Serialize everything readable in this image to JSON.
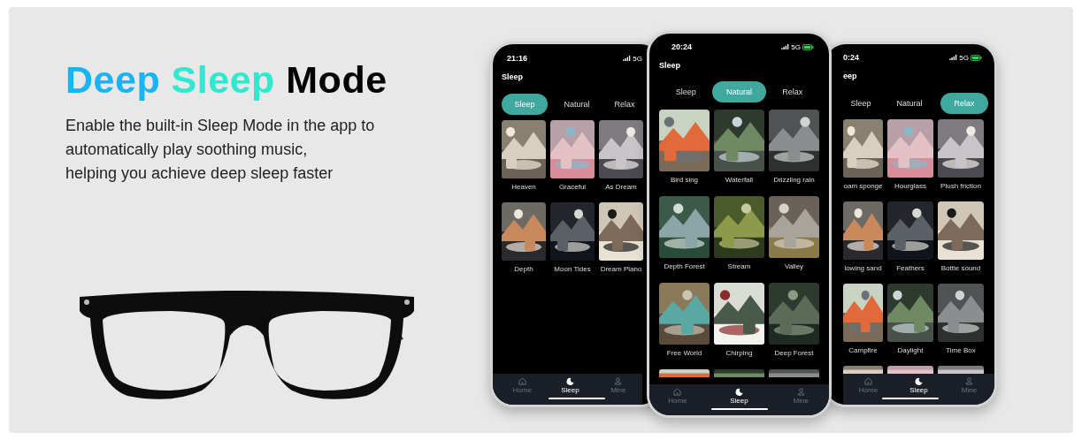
{
  "headline": [
    {
      "text": "Deep",
      "color": "#18b4f6"
    },
    {
      "text": "Sleep",
      "color": "#2ee8cf"
    },
    {
      "text": "Mode",
      "color": "#000000"
    }
  ],
  "description": "Enable the built-in Sleep Mode in the app to\nautomatically play soothing music,\nhelping you achieve deep sleep faster",
  "phones": [
    {
      "time": "21:16",
      "network": "5G",
      "battery": false,
      "header": "Sleep",
      "tabs": [
        {
          "label": "Sleep",
          "selected": true
        },
        {
          "label": "Natural",
          "selected": false
        },
        {
          "label": "Relax",
          "selected": false
        }
      ],
      "tiles": [
        {
          "label": "Heaven"
        },
        {
          "label": "Graceful"
        },
        {
          "label": "As Dream"
        },
        {
          "label": "Depth"
        },
        {
          "label": "Moon Tides"
        },
        {
          "label": "Dream Piano"
        }
      ],
      "partial_row": false,
      "nav": [
        {
          "label": "Home",
          "selected": false
        },
        {
          "label": "Sleep",
          "selected": true
        },
        {
          "label": "Mine",
          "selected": false
        }
      ]
    },
    {
      "time": "20:24",
      "network": "5G",
      "battery": true,
      "header": "Sleep",
      "tabs": [
        {
          "label": "Sleep",
          "selected": false
        },
        {
          "label": "Natural",
          "selected": true
        },
        {
          "label": "Relax",
          "selected": false
        }
      ],
      "tiles": [
        {
          "label": "Bird sing"
        },
        {
          "label": "Waterfall"
        },
        {
          "label": "Drizzling rain"
        },
        {
          "label": "Depth Forest"
        },
        {
          "label": "Stream"
        },
        {
          "label": "Valley"
        },
        {
          "label": "Free World"
        },
        {
          "label": "Chirping"
        },
        {
          "label": "Deep Forest"
        }
      ],
      "partial_row": true,
      "nav": [
        {
          "label": "Home",
          "selected": false
        },
        {
          "label": "Sleep",
          "selected": true
        },
        {
          "label": "Mine",
          "selected": false
        }
      ]
    },
    {
      "time": "0:24",
      "network": "5G",
      "battery": true,
      "header": "eep",
      "tabs": [
        {
          "label": "Sleep",
          "selected": false
        },
        {
          "label": "Natural",
          "selected": false
        },
        {
          "label": "Relax",
          "selected": true
        }
      ],
      "tiles": [
        {
          "label": "oam sponge"
        },
        {
          "label": "Hourglass"
        },
        {
          "label": "Plush friction"
        },
        {
          "label": "lowing sand"
        },
        {
          "label": "Feathers"
        },
        {
          "label": "Bottle sound"
        },
        {
          "label": "Campfire"
        },
        {
          "label": "Daylight"
        },
        {
          "label": "Time Box"
        }
      ],
      "partial_row": true,
      "nav": [
        {
          "label": "Home",
          "selected": false
        },
        {
          "label": "Sleep",
          "selected": true
        },
        {
          "label": "Mine",
          "selected": false
        }
      ]
    }
  ]
}
